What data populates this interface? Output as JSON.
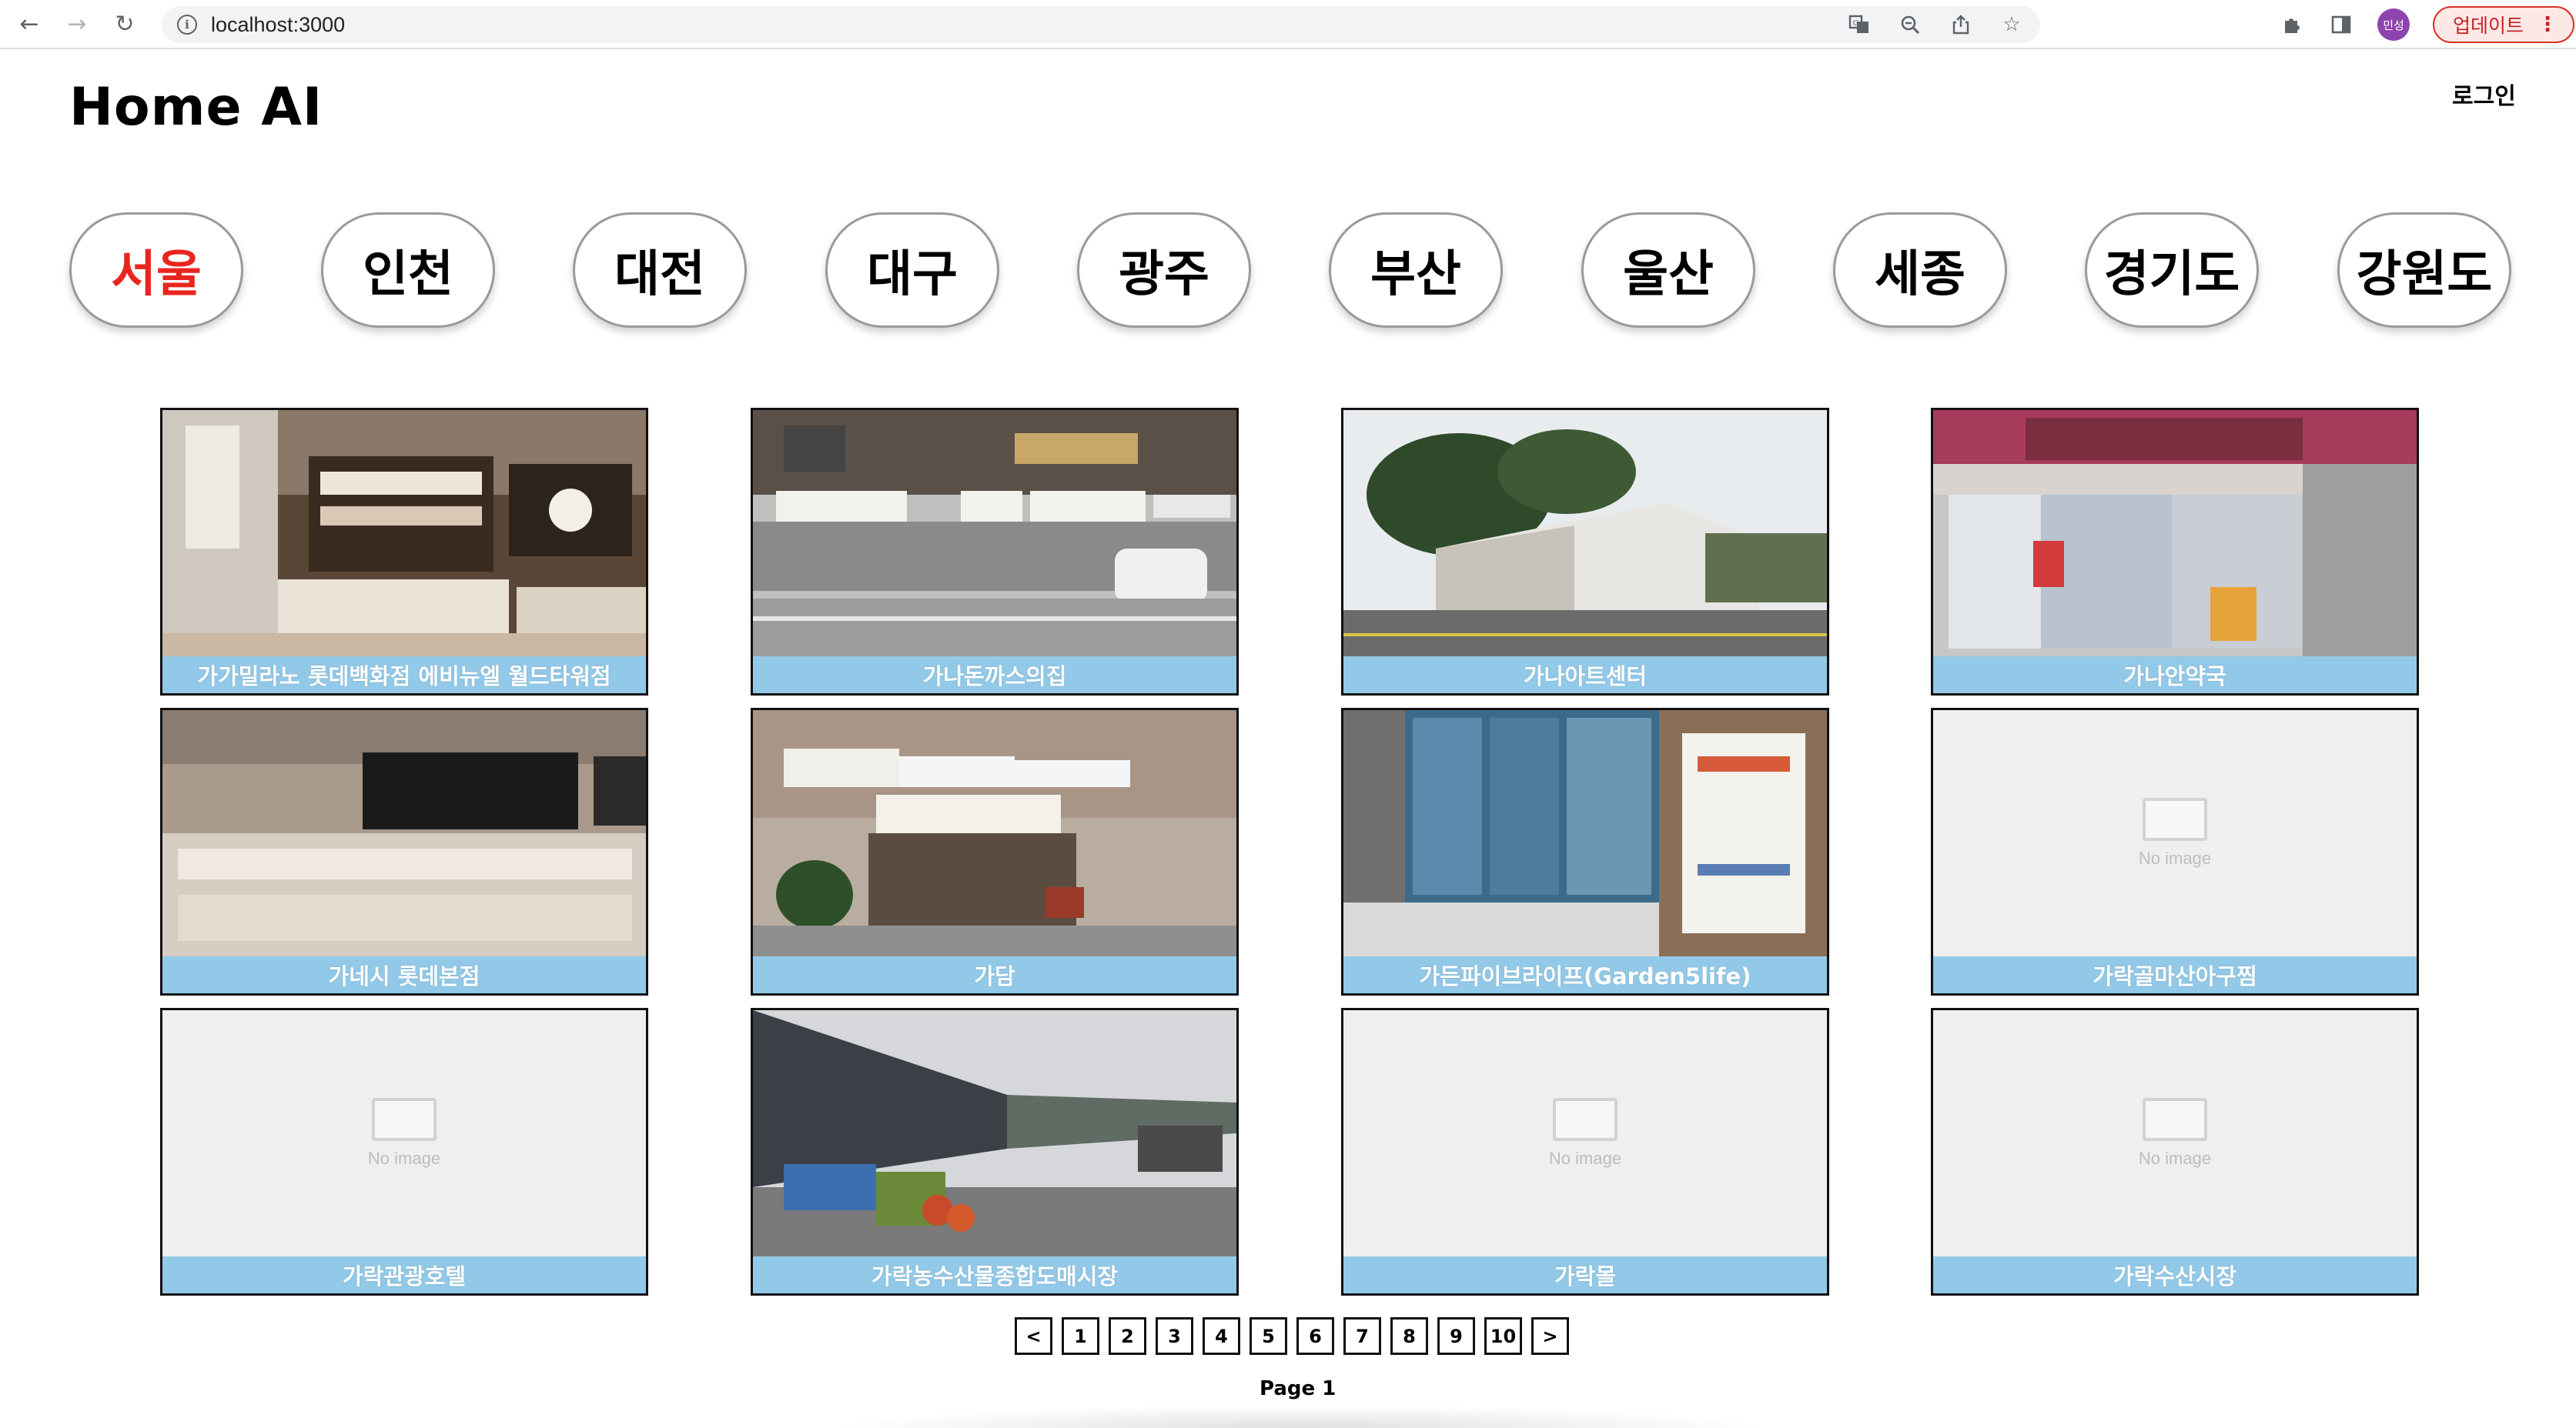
{
  "browser": {
    "url": "localhost:3000",
    "profile_initials": "민성",
    "update_label": "업데이트"
  },
  "header": {
    "title": "Home AI",
    "login_label": "로그인"
  },
  "regions": [
    {
      "label": "서울",
      "active": true
    },
    {
      "label": "인천",
      "active": false
    },
    {
      "label": "대전",
      "active": false
    },
    {
      "label": "대구",
      "active": false
    },
    {
      "label": "광주",
      "active": false
    },
    {
      "label": "부산",
      "active": false
    },
    {
      "label": "울산",
      "active": false
    },
    {
      "label": "세종",
      "active": false
    },
    {
      "label": "경기도",
      "active": false
    },
    {
      "label": "강원도",
      "active": false
    }
  ],
  "places": [
    {
      "name": "가가밀라노 롯데백화점 에비뉴엘 월드타워점",
      "image": "photo-jewelry-store"
    },
    {
      "name": "가나돈까스의집",
      "image": "photo-street-shops"
    },
    {
      "name": "가나아트센터",
      "image": "photo-art-center"
    },
    {
      "name": "가나안약국",
      "image": "photo-pharmacy"
    },
    {
      "name": "가네시 롯데본점",
      "image": "photo-display-cases"
    },
    {
      "name": "가담",
      "image": "photo-building-entrance"
    },
    {
      "name": "가든파이브라이프(Garden5life)",
      "image": "photo-glass-building"
    },
    {
      "name": "가락골마산아구찜",
      "image": "no-image"
    },
    {
      "name": "가락관광호텔",
      "image": "no-image"
    },
    {
      "name": "가락농수산물종합도매시장",
      "image": "photo-market"
    },
    {
      "name": "가락몰",
      "image": "no-image"
    },
    {
      "name": "가락수산시장",
      "image": "no-image"
    }
  ],
  "no_image_text": "No image",
  "pagination": {
    "prev": "<",
    "next": ">",
    "pages": [
      "1",
      "2",
      "3",
      "4",
      "5",
      "6",
      "7",
      "8",
      "9",
      "10"
    ],
    "current_label": "Page 1"
  }
}
